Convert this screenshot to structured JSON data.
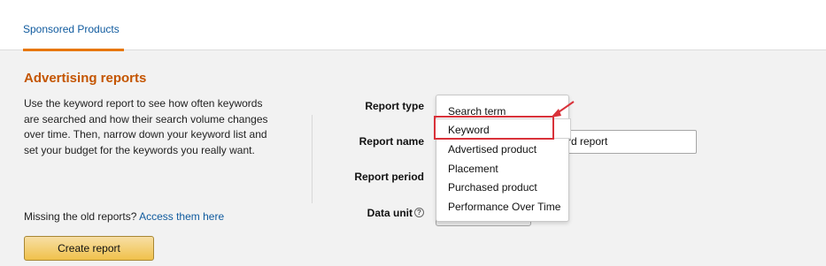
{
  "tabs": [
    {
      "label": "Sponsored Products",
      "active": true
    }
  ],
  "page": {
    "title": "Advertising reports",
    "description": "Use the keyword report to see how often keywords are searched and how their search volume changes over time. Then, narrow down your keyword list and set your budget for the keywords you really want.",
    "missing_text": "Missing the old reports?",
    "missing_link": "Access them here",
    "create_button": "Create report"
  },
  "form": {
    "report_type_label": "Report type",
    "report_name_label": "Report name",
    "report_period_label": "Report period",
    "data_unit_label": "Data unit",
    "report_name_value": "rd report"
  },
  "dropdown": {
    "options": [
      "Search term",
      "Keyword",
      "Advertised product",
      "Placement",
      "Purchased product",
      "Performance Over Time"
    ],
    "highlighted": "Keyword"
  },
  "colors": {
    "accent_orange": "#c45500",
    "link_blue": "#0f5a9e",
    "tab_underline": "#e77600",
    "annotation_red": "#d9323a",
    "button_yellow": "#f0c14b"
  },
  "icons": {
    "help": "question-circle-icon",
    "annotation": "red-arrow-icon"
  }
}
